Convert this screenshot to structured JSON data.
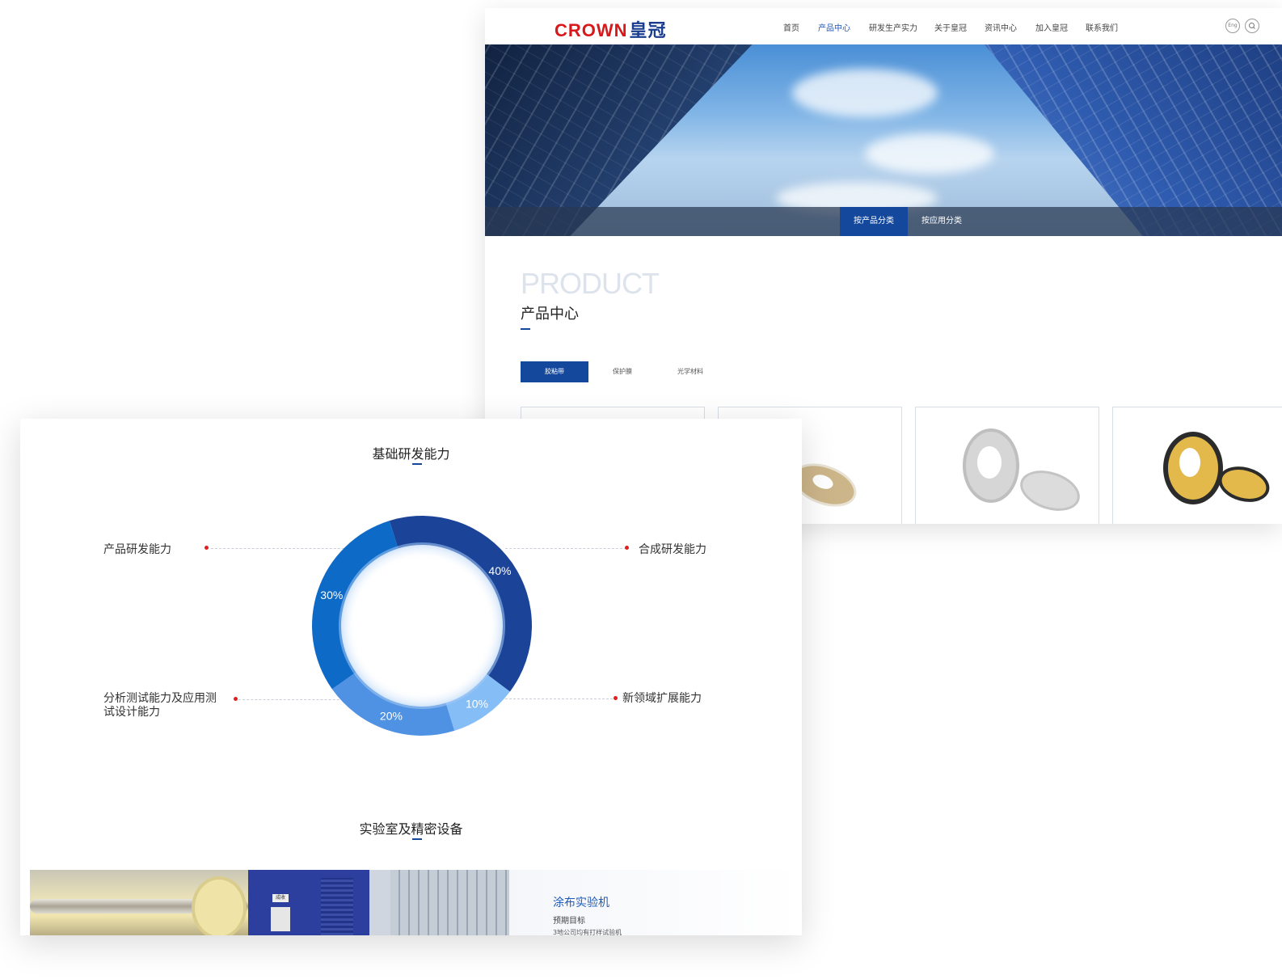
{
  "product_page": {
    "logo": {
      "en": "CROWN",
      "cn": "皇冠"
    },
    "nav": [
      "首页",
      "产品中心",
      "研发生产实力",
      "关于皇冠",
      "资讯中心",
      "加入皇冠",
      "联系我们"
    ],
    "nav_active_index": 1,
    "lang_button": "Eng",
    "hero_tabs": [
      "按产品分类",
      "按应用分类"
    ],
    "hero_tab_active_index": 0,
    "section_en": "PRODUCT",
    "section_cn": "产品中心",
    "categories": [
      "胶粘带",
      "保护膜",
      "光学材料"
    ],
    "category_active_index": 0
  },
  "rd_page": {
    "title": "基础研发能力",
    "labels": {
      "product_rd": "产品研发能力",
      "synthesis_rd": "合成研发能力",
      "analysis_line1": "分析测试能力及应用测",
      "analysis_line2": "试设计能力",
      "new_field": "新领域扩展能力"
    },
    "lab_title": "实验室及精密设备",
    "lab_item": {
      "name": "涂布实验机",
      "subtitle": "预期目标",
      "desc": "3地公司均有打样试验机"
    },
    "machine_sign": "成收"
  },
  "chart_data": {
    "type": "pie",
    "donut": true,
    "slices": [
      {
        "label": "40%",
        "value": 40,
        "color": "#1b4499"
      },
      {
        "label": "10%",
        "value": 10,
        "color": "#85bdf7"
      },
      {
        "label": "20%",
        "value": 20,
        "color": "#4f91e2"
      },
      {
        "label": "30%",
        "value": 30,
        "color": "#0e6ac7"
      }
    ]
  },
  "colors": {
    "brand_blue": "#14489c",
    "brand_red": "#d7191c",
    "accent_dot": "#e02020"
  }
}
